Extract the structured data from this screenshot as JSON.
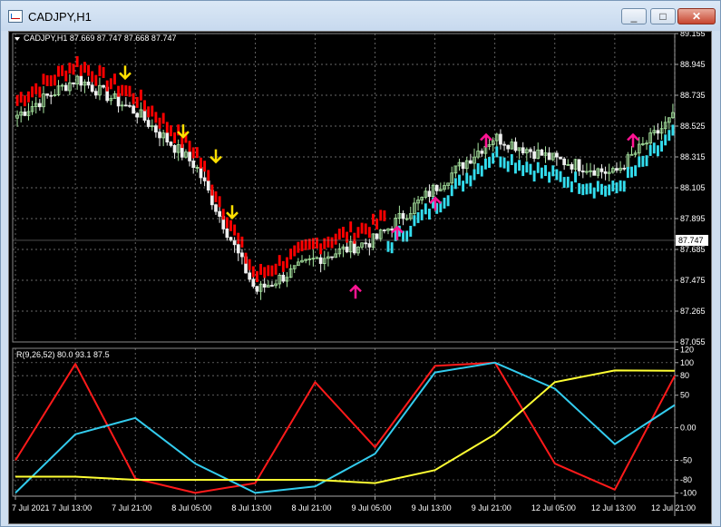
{
  "window": {
    "title": "CADJPY,H1",
    "minimize_glyph": "_",
    "maximize_glyph": "□",
    "close_glyph": "✕"
  },
  "main_chart": {
    "header": "CADJPY,H1  87.669 87.747 87.668 87.747",
    "price_axis": [
      "89.155",
      "88.945",
      "88.735",
      "88.525",
      "88.315",
      "88.105",
      "87.895",
      "87.685",
      "87.475",
      "87.265",
      "87.055"
    ],
    "current_price": "87.747",
    "ylim": [
      87.055,
      89.155
    ]
  },
  "indicator": {
    "header": "R(9,26,52) 80.0 93.1 87.5",
    "axis": [
      "120",
      "100",
      "80",
      "50",
      "0.00",
      "-50",
      "-80",
      "-100"
    ],
    "ylim": [
      -105,
      122
    ]
  },
  "time_axis": [
    "7 Jul 2021",
    "7 Jul 13:00",
    "7 Jul 21:00",
    "8 Jul 05:00",
    "8 Jul 13:00",
    "8 Jul 21:00",
    "9 Jul 05:00",
    "9 Jul 13:00",
    "9 Jul 21:00",
    "12 Jul 05:00",
    "12 Jul 13:00",
    "12 Jul 21:00"
  ],
  "colors": {
    "bull_candle": "#a8e6a1",
    "bear_candle": "#f0f0f0",
    "band_red": "#ff0000",
    "band_cyan": "#33ddee",
    "arrow_down": "#ffe000",
    "arrow_up": "#ff1493",
    "line_red": "#ff1a1a",
    "line_cyan": "#33ccee",
    "line_yellow": "#ffff33",
    "grid": "#8a8a8a"
  },
  "chart_data": [
    {
      "type": "candlestick",
      "title": "CADJPY,H1",
      "ylim": [
        87.055,
        89.155
      ],
      "key_closes": [
        {
          "x": "7 Jul 2021",
          "y": 88.6
        },
        {
          "x": "7 Jul 13:00",
          "y": 88.85
        },
        {
          "x": "7 Jul 21:00",
          "y": 88.62
        },
        {
          "x": "8 Jul 05:00",
          "y": 88.25
        },
        {
          "x": "8 Jul 13:00",
          "y": 87.4
        },
        {
          "x": "8 Jul 21:00",
          "y": 87.62
        },
        {
          "x": "9 Jul 05:00",
          "y": 87.75
        },
        {
          "x": "9 Jul 13:00",
          "y": 88.1
        },
        {
          "x": "9 Jul 21:00",
          "y": 88.45
        },
        {
          "x": "12 Jul 05:00",
          "y": 88.3
        },
        {
          "x": "12 Jul 13:00",
          "y": 88.2
        },
        {
          "x": "12 Jul 21:00",
          "y": 88.58
        }
      ],
      "band_switch": "red above price until 9 Jul 05:00, cyan below after"
    },
    {
      "type": "line",
      "title": "R(9,26,52)",
      "ylim": [
        -105,
        122
      ],
      "x": [
        "7 Jul 2021",
        "7 Jul 13:00",
        "7 Jul 21:00",
        "8 Jul 05:00",
        "8 Jul 13:00",
        "8 Jul 21:00",
        "9 Jul 05:00",
        "9 Jul 13:00",
        "9 Jul 21:00",
        "12 Jul 05:00",
        "12 Jul 13:00",
        "12 Jul 21:00"
      ],
      "series": [
        {
          "name": "R(9)",
          "color": "red",
          "values": [
            -50,
            98,
            -78,
            -100,
            -85,
            70,
            -30,
            95,
            100,
            -55,
            -95,
            80
          ]
        },
        {
          "name": "R(26)",
          "color": "cyan",
          "values": [
            -100,
            -10,
            15,
            -55,
            -100,
            -90,
            -40,
            85,
            100,
            60,
            -25,
            35
          ]
        },
        {
          "name": "R(52)",
          "color": "yellow",
          "values": [
            -75,
            -75,
            -80,
            -80,
            -80,
            -80,
            -85,
            -65,
            -10,
            70,
            88,
            87.5
          ]
        }
      ]
    }
  ]
}
